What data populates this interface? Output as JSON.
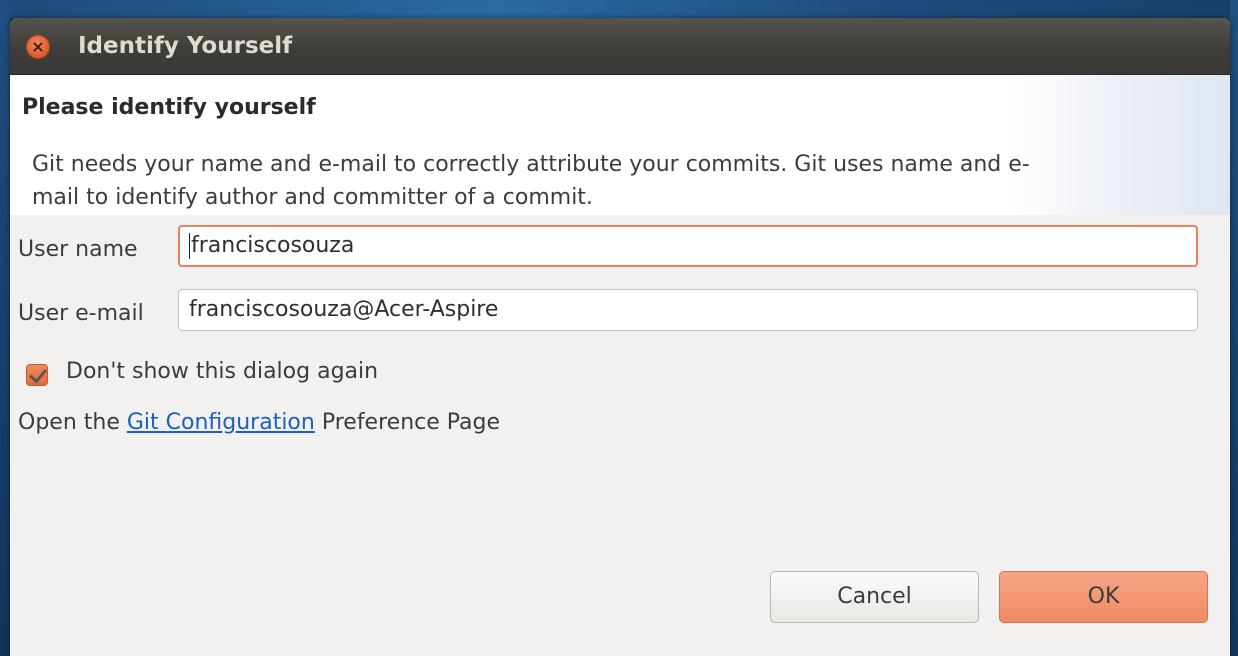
{
  "window": {
    "title": "Identify Yourself"
  },
  "banner": {
    "heading": "Please identify yourself",
    "description": "Git needs your name and e-mail to correctly attribute your commits. Git uses name and e-mail to identify author and committer of a commit."
  },
  "form": {
    "username_label": "User name",
    "username_value": "franciscosouza",
    "email_label": "User e-mail",
    "email_value": "franciscosouza@Acer-Aspire",
    "dont_show_label": "Don't show this dialog again",
    "dont_show_checked": true
  },
  "preference": {
    "prefix": "Open the ",
    "link_text": "Git Configuration",
    "suffix": " Preference Page"
  },
  "buttons": {
    "cancel": "Cancel",
    "ok": "OK"
  },
  "colors": {
    "accent": "#e8825c",
    "link": "#1f5fbf",
    "titlebar": "#3f3d39"
  }
}
